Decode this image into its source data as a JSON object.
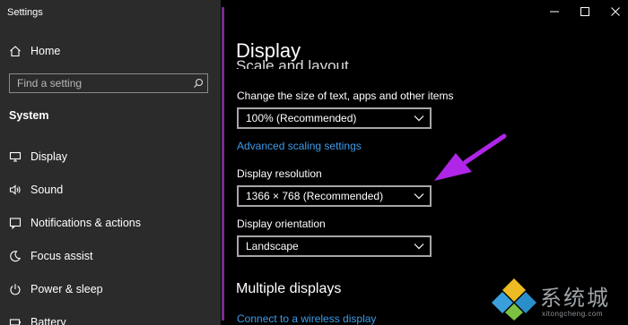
{
  "window": {
    "title": "Settings",
    "controls": [
      "minimize-icon",
      "maximize-icon",
      "close-icon"
    ]
  },
  "sidebar": {
    "home": {
      "label": "Home",
      "icon": "home-icon"
    },
    "search": {
      "placeholder": "Find a setting",
      "icon": "search-icon"
    },
    "section": "System",
    "items": [
      {
        "label": "Display",
        "icon": "monitor-icon"
      },
      {
        "label": "Sound",
        "icon": "speaker-icon"
      },
      {
        "label": "Notifications & actions",
        "icon": "notification-icon"
      },
      {
        "label": "Focus assist",
        "icon": "moon-icon"
      },
      {
        "label": "Power & sleep",
        "icon": "power-icon"
      },
      {
        "label": "Battery",
        "icon": "battery-icon"
      }
    ]
  },
  "main": {
    "title": "Display",
    "scale_heading": "Scale and layout",
    "scale": {
      "label": "Change the size of text, apps and other items",
      "value": "100% (Recommended)"
    },
    "advanced_link": "Advanced scaling settings",
    "resolution": {
      "label": "Display resolution",
      "value": "1366 × 768 (Recommended)"
    },
    "orientation": {
      "label": "Display orientation",
      "value": "Landscape"
    },
    "multiple_heading": "Multiple displays",
    "wireless_link": "Connect to a wireless display"
  },
  "annotation": {
    "arrow_color": "#b026e8"
  },
  "watermark": {
    "text": "系统城",
    "sub": "xitongcheng.com"
  },
  "colors": {
    "sidebar_bg": "#2b2b2b",
    "main_bg": "#000000",
    "link": "#3d9be9",
    "accent_bar": "#7a2b8f"
  }
}
